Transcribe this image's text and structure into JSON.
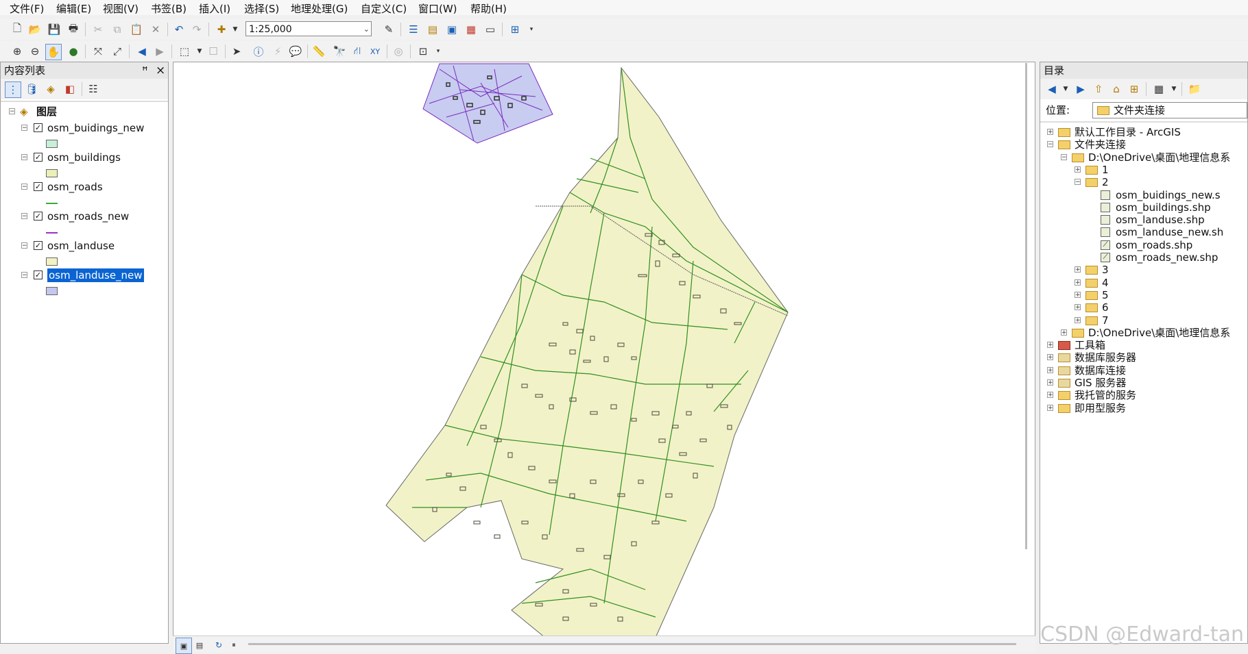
{
  "menu": [
    "文件(F)",
    "编辑(E)",
    "视图(V)",
    "书签(B)",
    "插入(I)",
    "选择(S)",
    "地理处理(G)",
    "自定义(C)",
    "窗口(W)",
    "帮助(H)"
  ],
  "scale": "1:25,000",
  "toc": {
    "title": "内容列表",
    "pin": "ꟸ",
    "close": "×",
    "root": "图层",
    "layers": [
      {
        "name": "osm_buidings_new",
        "checked": true,
        "symbol": "polygon",
        "color": "#c8f0d8"
      },
      {
        "name": "osm_buildings",
        "checked": true,
        "symbol": "polygon",
        "color": "#eaf0b8"
      },
      {
        "name": "osm_roads",
        "checked": true,
        "symbol": "line",
        "color": "#3aa83a"
      },
      {
        "name": "osm_roads_new",
        "checked": true,
        "symbol": "line",
        "color": "#9b30c8"
      },
      {
        "name": "osm_landuse",
        "checked": true,
        "symbol": "polygon",
        "color": "#f2f2c4"
      },
      {
        "name": "osm_landuse_new",
        "checked": true,
        "symbol": "polygon",
        "color": "#c4c8ee",
        "selected": true
      }
    ]
  },
  "catalog": {
    "title": "目录",
    "location_label": "位置:",
    "location_value": "文件夹连接",
    "items": [
      {
        "label": "默认工作目录 - ArcGIS",
        "depth": 0,
        "exp": "+",
        "icon": "home"
      },
      {
        "label": "文件夹连接",
        "depth": 0,
        "exp": "−",
        "icon": "folder"
      },
      {
        "label": "D:\\OneDrive\\桌面\\地理信息系",
        "depth": 1,
        "exp": "−",
        "icon": "folder"
      },
      {
        "label": "1",
        "depth": 2,
        "exp": "+",
        "icon": "folder"
      },
      {
        "label": "2",
        "depth": 2,
        "exp": "−",
        "icon": "folder"
      },
      {
        "label": "osm_buidings_new.s",
        "depth": 3,
        "exp": "",
        "icon": "shp"
      },
      {
        "label": "osm_buildings.shp",
        "depth": 3,
        "exp": "",
        "icon": "shp"
      },
      {
        "label": "osm_landuse.shp",
        "depth": 3,
        "exp": "",
        "icon": "shp"
      },
      {
        "label": "osm_landuse_new.sh",
        "depth": 3,
        "exp": "",
        "icon": "shp"
      },
      {
        "label": "osm_roads.shp",
        "depth": 3,
        "exp": "",
        "icon": "line"
      },
      {
        "label": "osm_roads_new.shp",
        "depth": 3,
        "exp": "",
        "icon": "line"
      },
      {
        "label": "3",
        "depth": 2,
        "exp": "+",
        "icon": "folder"
      },
      {
        "label": "4",
        "depth": 2,
        "exp": "+",
        "icon": "folder"
      },
      {
        "label": "5",
        "depth": 2,
        "exp": "+",
        "icon": "folder"
      },
      {
        "label": "6",
        "depth": 2,
        "exp": "+",
        "icon": "folder"
      },
      {
        "label": "7",
        "depth": 2,
        "exp": "+",
        "icon": "folder"
      },
      {
        "label": "D:\\OneDrive\\桌面\\地理信息系",
        "depth": 1,
        "exp": "+",
        "icon": "folder"
      },
      {
        "label": "工具箱",
        "depth": 0,
        "exp": "+",
        "icon": "toolbox"
      },
      {
        "label": "数据库服务器",
        "depth": 0,
        "exp": "+",
        "icon": "db"
      },
      {
        "label": "数据库连接",
        "depth": 0,
        "exp": "+",
        "icon": "db"
      },
      {
        "label": "GIS 服务器",
        "depth": 0,
        "exp": "+",
        "icon": "db"
      },
      {
        "label": "我托管的服务",
        "depth": 0,
        "exp": "+",
        "icon": "folder"
      },
      {
        "label": "即用型服务",
        "depth": 0,
        "exp": "+",
        "icon": "folder"
      }
    ]
  },
  "watermark": "CSDN @Edward-tan",
  "colors": {
    "landuse": "#f2f2c8",
    "roads": "#2f8f1f",
    "roads_new": "#7a2cc0",
    "landuse_new": "#c8ccf0",
    "buildings": "#4a4a3a"
  }
}
